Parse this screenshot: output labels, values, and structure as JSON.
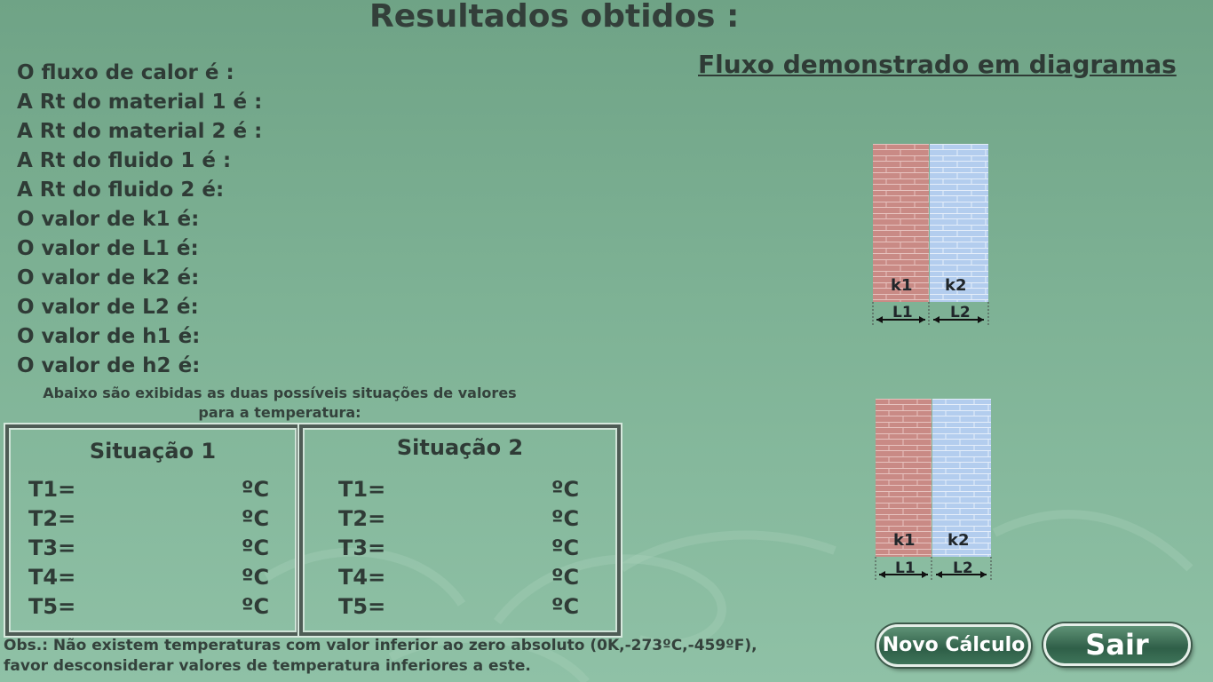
{
  "title": "Resultados obtidos :",
  "results": [
    "O fluxo de calor é :",
    "A Rt do material 1 é :",
    "A Rt do material 2 é :",
    "A Rt do fluido 1 é :",
    "A Rt do fluido 2 é:",
    "O valor de k1 é:",
    "O valor de L1 é:",
    "O valor de k2 é:",
    "O valor de L2 é:",
    "O valor de h1 é:",
    "O valor de h2 é:"
  ],
  "diagram_title": "Fluxo demonstrado em diagramas",
  "diagrams": [
    {
      "k1": "k1",
      "k2": "k2",
      "l1": "L1",
      "l2": "L2"
    },
    {
      "k1": "k1",
      "k2": "k2",
      "l1": "L1",
      "l2": "L2"
    }
  ],
  "note_line1": "Abaixo são exibidas as duas possíveis situações de valores",
  "note_line2": "para a temperatura:",
  "situation1": {
    "title": "Situação 1",
    "rows": [
      {
        "label": "T1=",
        "unit": "ºC"
      },
      {
        "label": "T2=",
        "unit": "ºC"
      },
      {
        "label": "T3=",
        "unit": "ºC"
      },
      {
        "label": "T4=",
        "unit": "ºC"
      },
      {
        "label": "T5=",
        "unit": "ºC"
      }
    ]
  },
  "situation2": {
    "title": "Situação 2",
    "rows": [
      {
        "label": "T1=",
        "unit": "ºC"
      },
      {
        "label": "T2=",
        "unit": "ºC"
      },
      {
        "label": "T3=",
        "unit": "ºC"
      },
      {
        "label": "T4=",
        "unit": "ºC"
      },
      {
        "label": "T5=",
        "unit": "ºC"
      }
    ]
  },
  "obs_line1": "Obs.: Não existem temperaturas com valor inferior ao zero absoluto (0K,-273ºC,-459ºF),",
  "obs_line2": "favor desconsiderar valores de temperatura inferiores a este.",
  "buttons": {
    "novo": "Novo Cálculo",
    "sair": "Sair"
  },
  "colors": {
    "material1": "#c98a85",
    "material2": "#b3cdee",
    "button": "#2f5f48"
  }
}
